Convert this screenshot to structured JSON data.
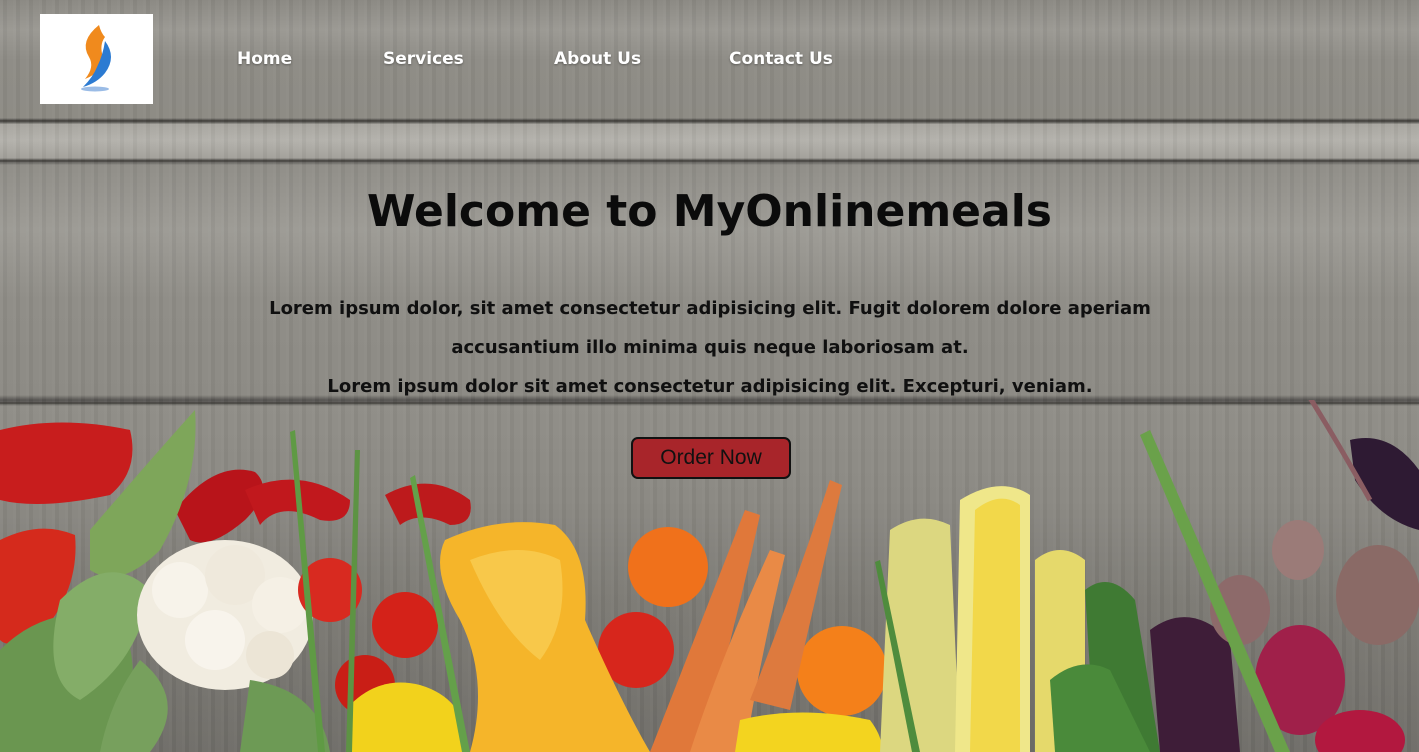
{
  "brand": {
    "logo": "flame-logo-icon"
  },
  "nav": {
    "items": [
      {
        "label": "Home"
      },
      {
        "label": "Services"
      },
      {
        "label": "About Us"
      },
      {
        "label": "Contact Us"
      }
    ]
  },
  "hero": {
    "title": "Welcome to MyOnlinemeals",
    "lines": [
      "Lorem ipsum dolor, sit amet consectetur adipisicing elit. Fugit dolorem dolore aperiam",
      "accusantium illo minima quis neque laboriosam at.",
      "Lorem ipsum dolor sit amet consectetur adipisicing elit. Excepturi, veniam."
    ],
    "cta_label": "Order Now"
  },
  "colors": {
    "cta_background": "#a8252a",
    "nav_text": "#ffffff",
    "title_text": "#0b0b0b"
  }
}
